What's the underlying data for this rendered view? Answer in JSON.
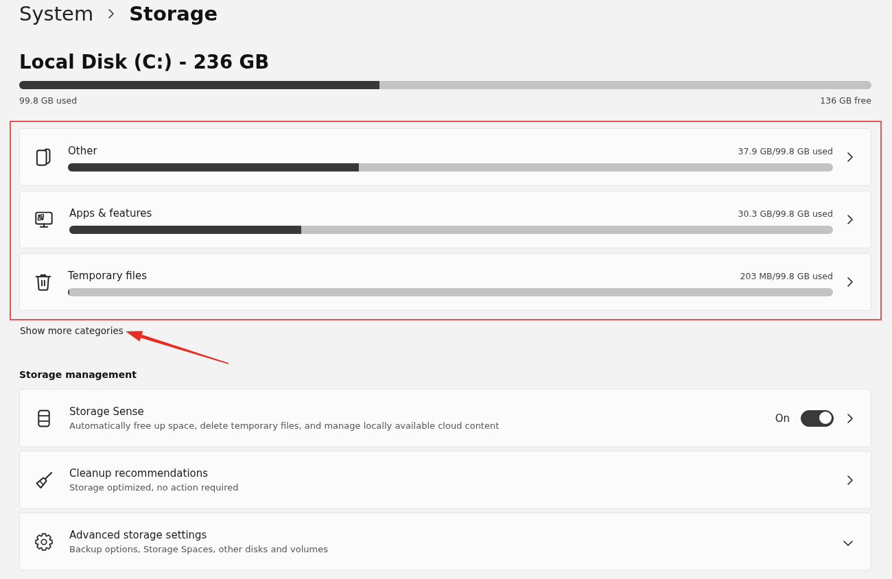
{
  "breadcrumb": {
    "parent": "System",
    "current": "Storage"
  },
  "disk": {
    "title": "Local Disk (C:) - 236 GB",
    "level": 0.423,
    "used": "99.8 GB used",
    "free": "136 GB free"
  },
  "categories": [
    {
      "name": "Other",
      "usage": "37.9 GB/99.8 GB used",
      "level": 0.38
    },
    {
      "name": "Apps & features",
      "usage": "30.3 GB/99.8 GB used",
      "level": 0.304
    },
    {
      "name": "Temporary files",
      "usage": "203 MB/99.8 GB used",
      "level": 0.002
    }
  ],
  "show_more": "Show more categories",
  "storage_management": {
    "heading": "Storage management",
    "items": [
      {
        "kind": "toggle",
        "title": "Storage Sense",
        "description": "Automatically free up space, delete temporary files, and manage locally available cloud content",
        "toggle": {
          "label": "On",
          "on": true
        }
      },
      {
        "kind": "link",
        "title": "Cleanup recommendations",
        "description": "Storage optimized, no action required"
      },
      {
        "kind": "expander",
        "title": "Advanced storage settings",
        "description": "Backup options, Storage Spaces, other disks and volumes",
        "expanded": false
      }
    ]
  }
}
